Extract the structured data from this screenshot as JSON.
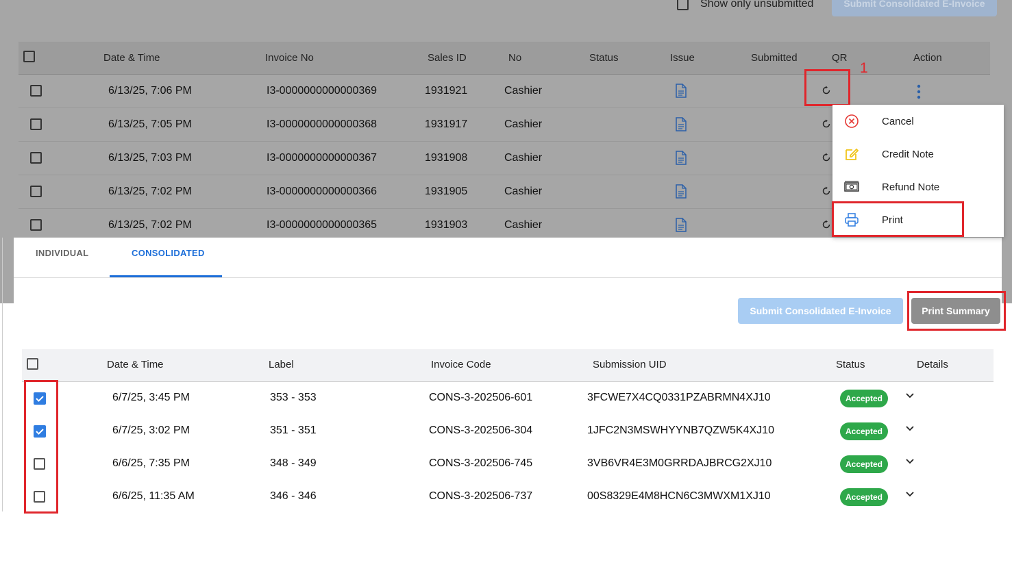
{
  "top_panel": {
    "show_unsubmitted_label": "Show only unsubmitted",
    "submit_button_label": "Submit Consolidated E-Invoice",
    "columns": [
      "Date & Time",
      "Invoice No",
      "Sales ID",
      "No",
      "Status",
      "Issue",
      "Submitted",
      "QR",
      "Action"
    ],
    "rows": [
      {
        "date": "6/13/25, 7:06 PM",
        "invoice": "I3-0000000000000369",
        "sales_id": "1931921",
        "no": "Cashier"
      },
      {
        "date": "6/13/25, 7:05 PM",
        "invoice": "I3-0000000000000368",
        "sales_id": "1931917",
        "no": "Cashier"
      },
      {
        "date": "6/13/25, 7:03 PM",
        "invoice": "I3-0000000000000367",
        "sales_id": "1931908",
        "no": "Cashier"
      },
      {
        "date": "6/13/25, 7:02 PM",
        "invoice": "I3-0000000000000366",
        "sales_id": "1931905",
        "no": "Cashier"
      },
      {
        "date": "6/13/25, 7:02 PM",
        "invoice": "I3-0000000000000365",
        "sales_id": "1931903",
        "no": "Cashier"
      }
    ],
    "annotation_number": "1"
  },
  "action_menu": {
    "items": [
      {
        "label": "Cancel",
        "icon": "cancel-circle-icon"
      },
      {
        "label": "Credit Note",
        "icon": "edit-note-icon"
      },
      {
        "label": "Refund Note",
        "icon": "cash-icon"
      },
      {
        "label": "Print",
        "icon": "printer-icon"
      }
    ]
  },
  "tabs": [
    {
      "label": "INDIVIDUAL",
      "active": false
    },
    {
      "label": "CONSOLIDATED",
      "active": true
    }
  ],
  "toolbar": {
    "submit_label": "Submit Consolidated E-Invoice",
    "print_summary_label": "Print Summary"
  },
  "consolidated_table": {
    "columns": [
      "Date & Time",
      "Label",
      "Invoice Code",
      "Submission UID",
      "Status",
      "Details"
    ],
    "rows": [
      {
        "checked": true,
        "date": "6/7/25, 3:45 PM",
        "label": "353 - 353",
        "code": "CONS-3-202506-601",
        "uid": "3FCWE7X4CQ0331PZABRMN4XJ10",
        "status": "Accepted"
      },
      {
        "checked": true,
        "date": "6/7/25, 3:02 PM",
        "label": "351 - 351",
        "code": "CONS-3-202506-304",
        "uid": "1JFC2N3MSWHYYNB7QZW5K4XJ10",
        "status": "Accepted"
      },
      {
        "checked": false,
        "date": "6/6/25, 7:35 PM",
        "label": "348 - 349",
        "code": "CONS-3-202506-745",
        "uid": "3VB6VR4E3M0GRRDAJBRCG2XJ10",
        "status": "Accepted"
      },
      {
        "checked": false,
        "date": "6/6/25, 11:35 AM",
        "label": "346 - 346",
        "code": "CONS-3-202506-737",
        "uid": "00S8329E4M8HCN6C3MWXM1XJ10",
        "status": "Accepted"
      }
    ]
  },
  "colors": {
    "accent": "#1e6fd9",
    "highlight": "#e0262c",
    "accepted": "#2ea84a"
  }
}
